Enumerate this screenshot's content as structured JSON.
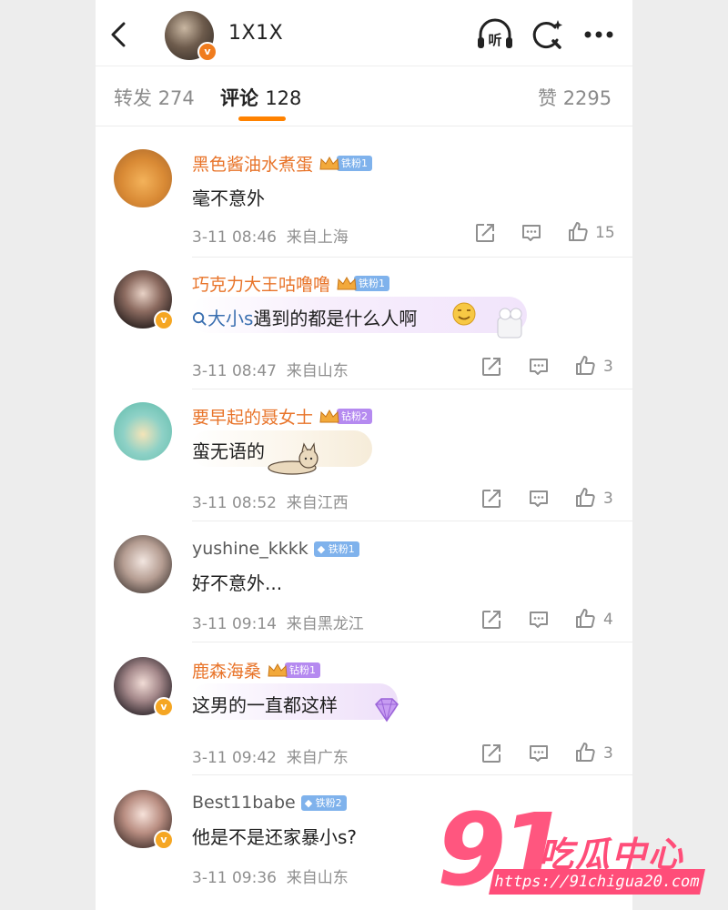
{
  "header": {
    "name": "1X1X",
    "listen_label": "听"
  },
  "tabs": [
    {
      "label": "转发",
      "count": "274"
    },
    {
      "label": "评论",
      "count": "128"
    },
    {
      "label": "赞",
      "count": "2295"
    }
  ],
  "comments": [
    {
      "name": "黑色酱油水煮蛋",
      "badge": "铁粉1",
      "text": "毫不意外",
      "time": "3-11 08:46",
      "source": "来自上海",
      "likes": "15"
    },
    {
      "name": "巧克力大王咕噜噜",
      "badge": "铁粉1",
      "link": "大小s",
      "text": "遇到的都是什么人啊",
      "time": "3-11 08:47",
      "source": "来自山东",
      "likes": "3"
    },
    {
      "name": "要早起的聂女士",
      "badge": "钻粉2",
      "text": "蛮无语的",
      "time": "3-11 08:52",
      "source": "来自江西",
      "likes": "3"
    },
    {
      "name": "yushine_kkkk",
      "badge": "铁粉1",
      "text": "好不意外...",
      "time": "3-11 09:14",
      "source": "来自黑龙江",
      "likes": "4"
    },
    {
      "name": "鹿森海桑",
      "badge": "钻粉1",
      "text": "这男的一直都这样",
      "time": "3-11 09:42",
      "source": "来自广东",
      "likes": "3"
    },
    {
      "name": "Best11babe",
      "badge": "铁粉2",
      "text": "他是不是还家暴小s?",
      "time": "3-11 09:36",
      "source": "来自山东",
      "likes": ""
    }
  ],
  "watermark": {
    "number": "91",
    "text": "吃瓜中心",
    "url": "https://91chigua20.com"
  }
}
